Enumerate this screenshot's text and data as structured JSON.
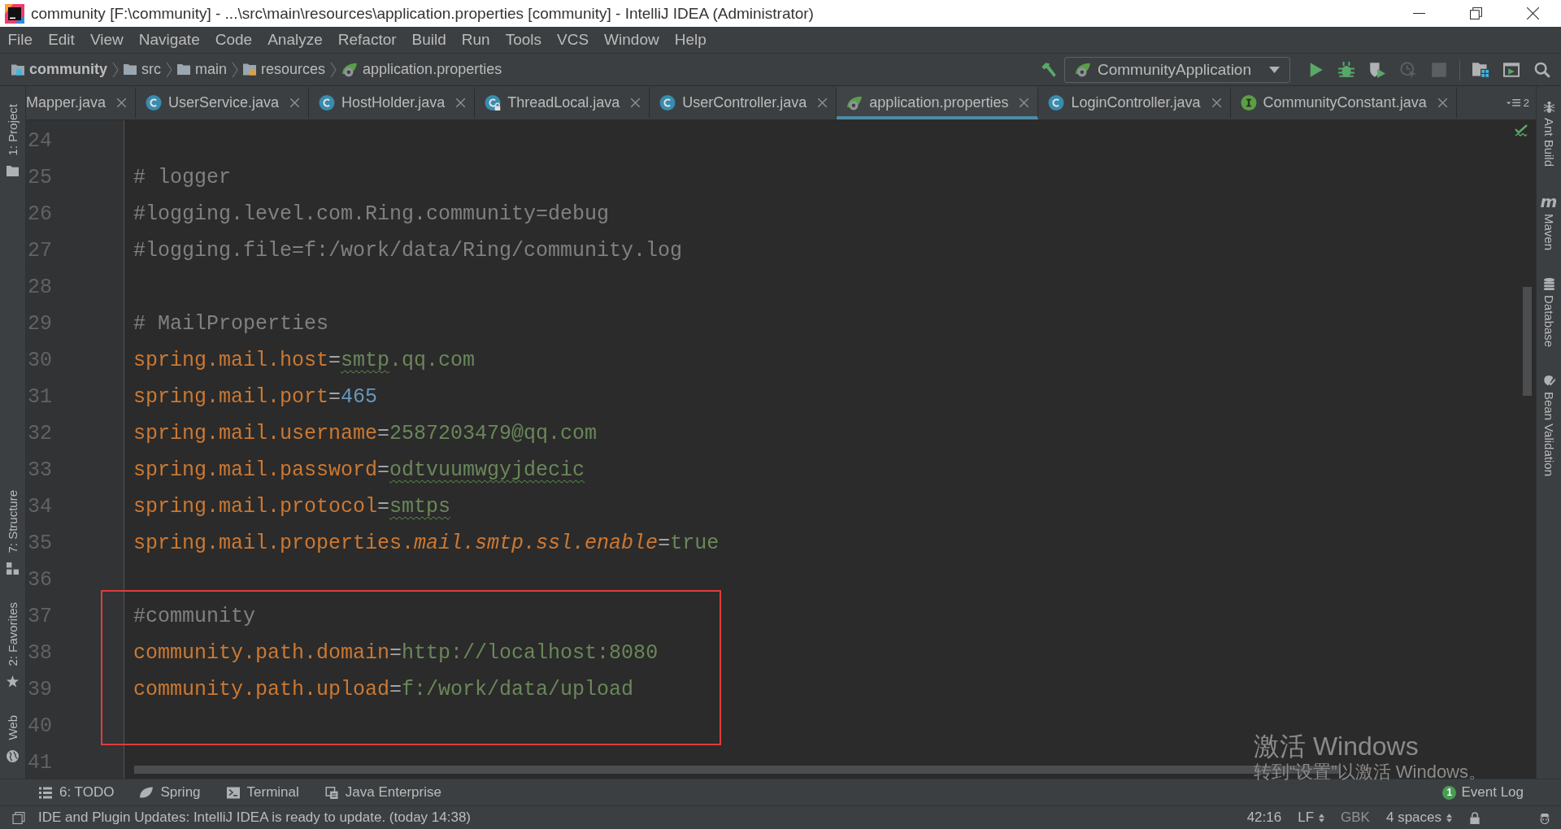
{
  "window": {
    "title": "community [F:\\community] - ...\\src\\main\\resources\\application.properties [community] - IntelliJ IDEA (Administrator)"
  },
  "menu_bar": [
    "File",
    "Edit",
    "View",
    "Navigate",
    "Code",
    "Analyze",
    "Refactor",
    "Build",
    "Run",
    "Tools",
    "VCS",
    "Window",
    "Help"
  ],
  "navigation_bar": {
    "breadcrumbs": [
      {
        "label": "community",
        "kind": "module"
      },
      {
        "label": "src",
        "kind": "folder"
      },
      {
        "label": "main",
        "kind": "folder"
      },
      {
        "label": "resources",
        "kind": "resources"
      },
      {
        "label": "application.properties",
        "kind": "properties"
      }
    ],
    "run_configuration": "CommunityApplication",
    "actions": [
      {
        "kind": "run",
        "disabled": false
      },
      {
        "kind": "debug",
        "disabled": false
      },
      {
        "kind": "coverage",
        "disabled": false
      },
      {
        "kind": "profile",
        "disabled": true
      },
      {
        "kind": "stop",
        "disabled": true
      }
    ]
  },
  "tabs": [
    {
      "label": "Mapper.java",
      "selected": false
    },
    {
      "label": "UserService.java",
      "kind": "class",
      "selected": false
    },
    {
      "label": "HostHolder.java",
      "kind": "class",
      "selected": false
    },
    {
      "label": "ThreadLocal.java",
      "kind": "locked",
      "selected": false
    },
    {
      "label": "UserController.java",
      "kind": "class",
      "selected": false
    },
    {
      "label": "application.properties",
      "kind": "properties",
      "selected": true
    },
    {
      "label": "LoginController.java",
      "kind": "class",
      "selected": false
    },
    {
      "label": "CommunityConstant.java",
      "kind": "interface",
      "selected": false
    }
  ],
  "tab_overflow_count": "2",
  "left_tool_strip": [
    {
      "label": "1: Project",
      "kind": "project"
    },
    {
      "label": "7: Structure",
      "kind": "structure"
    },
    {
      "label": "2: Favorites",
      "kind": "favorites"
    },
    {
      "label": "Web",
      "kind": "web"
    }
  ],
  "editor": {
    "lines": [
      {
        "number": "24",
        "boxed": false
      },
      {
        "number": "25",
        "boxed": false,
        "tokens": [
          {
            "text": "# logger",
            "kind": "comment",
            "typo": false
          }
        ]
      },
      {
        "number": "26",
        "boxed": false,
        "tokens": [
          {
            "text": "#logging.level.com.Ring.community=debug",
            "kind": "comment",
            "typo": false
          }
        ]
      },
      {
        "number": "27",
        "boxed": false,
        "tokens": [
          {
            "text": "#logging.file=f:/work/data/Ring/community.log",
            "kind": "comment",
            "typo": false
          }
        ]
      },
      {
        "number": "28",
        "boxed": false
      },
      {
        "number": "29",
        "boxed": false,
        "tokens": [
          {
            "text": "# MailProperties",
            "kind": "comment",
            "typo": false
          }
        ]
      },
      {
        "number": "30",
        "boxed": false,
        "tokens": [
          {
            "text": "spring.mail.host",
            "kind": "key",
            "typo": false
          },
          {
            "text": "=",
            "kind": "sep",
            "typo": false
          },
          {
            "text": "smtp",
            "kind": "string",
            "typo": true
          },
          {
            "text": ".qq.com",
            "kind": "string",
            "typo": false
          }
        ]
      },
      {
        "number": "31",
        "boxed": false,
        "tokens": [
          {
            "text": "spring.mail.port",
            "kind": "key",
            "typo": false
          },
          {
            "text": "=",
            "kind": "sep",
            "typo": false
          },
          {
            "text": "465",
            "kind": "number",
            "typo": false
          }
        ]
      },
      {
        "number": "32",
        "boxed": false,
        "tokens": [
          {
            "text": "spring.mail.username",
            "kind": "key",
            "typo": false
          },
          {
            "text": "=",
            "kind": "sep",
            "typo": false
          },
          {
            "text": "2587203479@qq.com",
            "kind": "string",
            "typo": false
          }
        ]
      },
      {
        "number": "33",
        "boxed": false,
        "tokens": [
          {
            "text": "spring.mail.password",
            "kind": "key",
            "typo": false
          },
          {
            "text": "=",
            "kind": "sep",
            "typo": false
          },
          {
            "text": "odtvuumwgyjdecic",
            "kind": "string",
            "typo": true
          }
        ]
      },
      {
        "number": "34",
        "boxed": false,
        "tokens": [
          {
            "text": "spring.mail.protocol",
            "kind": "key",
            "typo": false
          },
          {
            "text": "=",
            "kind": "sep",
            "typo": false
          },
          {
            "text": "smtps",
            "kind": "string",
            "typo": true
          }
        ]
      },
      {
        "number": "35",
        "boxed": false,
        "tokens": [
          {
            "text": "spring.mail.properties.",
            "kind": "key",
            "typo": false
          },
          {
            "text": "mail.smtp.ssl.enable",
            "kind": "key-italic",
            "typo": false
          },
          {
            "text": "=",
            "kind": "sep",
            "typo": false
          },
          {
            "text": "true",
            "kind": "string",
            "typo": false
          }
        ]
      },
      {
        "number": "36",
        "boxed": false
      },
      {
        "number": "37",
        "boxed": true,
        "tokens": [
          {
            "text": "#community",
            "kind": "comment",
            "typo": false
          }
        ]
      },
      {
        "number": "38",
        "boxed": true,
        "tokens": [
          {
            "text": "community.path.domain",
            "kind": "key",
            "typo": false
          },
          {
            "text": "=",
            "kind": "sep",
            "typo": false
          },
          {
            "text": "http://localhost:8080",
            "kind": "string",
            "typo": false
          }
        ]
      },
      {
        "number": "39",
        "boxed": true,
        "tokens": [
          {
            "text": "community.path.upload",
            "kind": "key",
            "typo": false
          },
          {
            "text": "=",
            "kind": "sep",
            "typo": false
          },
          {
            "text": "f:/work/data/upload",
            "kind": "string",
            "typo": false
          }
        ]
      },
      {
        "number": "40",
        "boxed": true
      },
      {
        "number": "41",
        "boxed": false
      }
    ]
  },
  "right_tool_strip": [
    {
      "label": "Ant Build",
      "kind": "ant"
    },
    {
      "label": "Maven",
      "kind": "letter",
      "glyph": "m"
    },
    {
      "label": "Database",
      "kind": "database"
    },
    {
      "label": "Bean Validation",
      "kind": "bean"
    }
  ],
  "tool_window_bar": {
    "items": [
      {
        "label": "6: TODO",
        "kind": "todo"
      },
      {
        "label": "Spring",
        "kind": "spring"
      },
      {
        "label": "Terminal",
        "kind": "terminal"
      },
      {
        "label": "Java Enterprise",
        "kind": "enterprise"
      }
    ],
    "event_log": {
      "label": "Event Log",
      "badge": "1"
    }
  },
  "status_bar": {
    "message": "IDE and Plugin Updates: IntelliJ IDEA is ready to update. (today 14:38)",
    "position": "42:16",
    "line_separator": "LF",
    "encoding": "GBK",
    "indent": "4 spaces"
  },
  "activation_notice": {
    "title": "激活 Windows",
    "subtitle": "转到“设置”以激活 Windows。"
  }
}
